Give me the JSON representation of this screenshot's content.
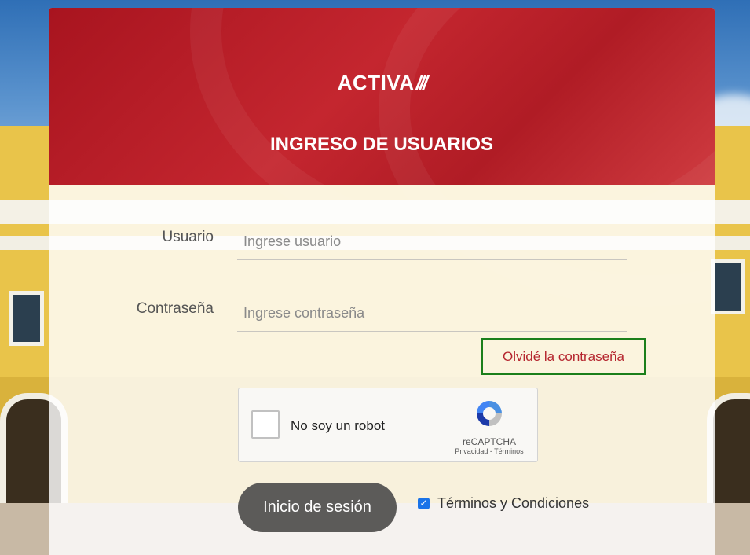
{
  "header": {
    "brand": "ACTIVA",
    "brand_mark": "///",
    "title": "INGRESO DE USUARIOS"
  },
  "form": {
    "username_label": "Usuario",
    "username_placeholder": "Ingrese usuario",
    "username_value": "",
    "password_label": "Contraseña",
    "password_placeholder": "Ingrese contraseña",
    "password_value": "",
    "forgot_link": "Olvidé la contraseña"
  },
  "captcha": {
    "label": "No soy un robot",
    "brand": "reCAPTCHA",
    "links": "Privacidad - Términos",
    "checked": false
  },
  "actions": {
    "login_button": "Inicio de sesión",
    "terms_label": "Términos y Condiciones",
    "terms_checked": true
  },
  "colors": {
    "header_red": "#b01c25",
    "forgot_text": "#b5252e",
    "highlight_border": "#1b7f1b",
    "button_gray": "#5c5b59",
    "checkbox_blue": "#1a73e8"
  }
}
